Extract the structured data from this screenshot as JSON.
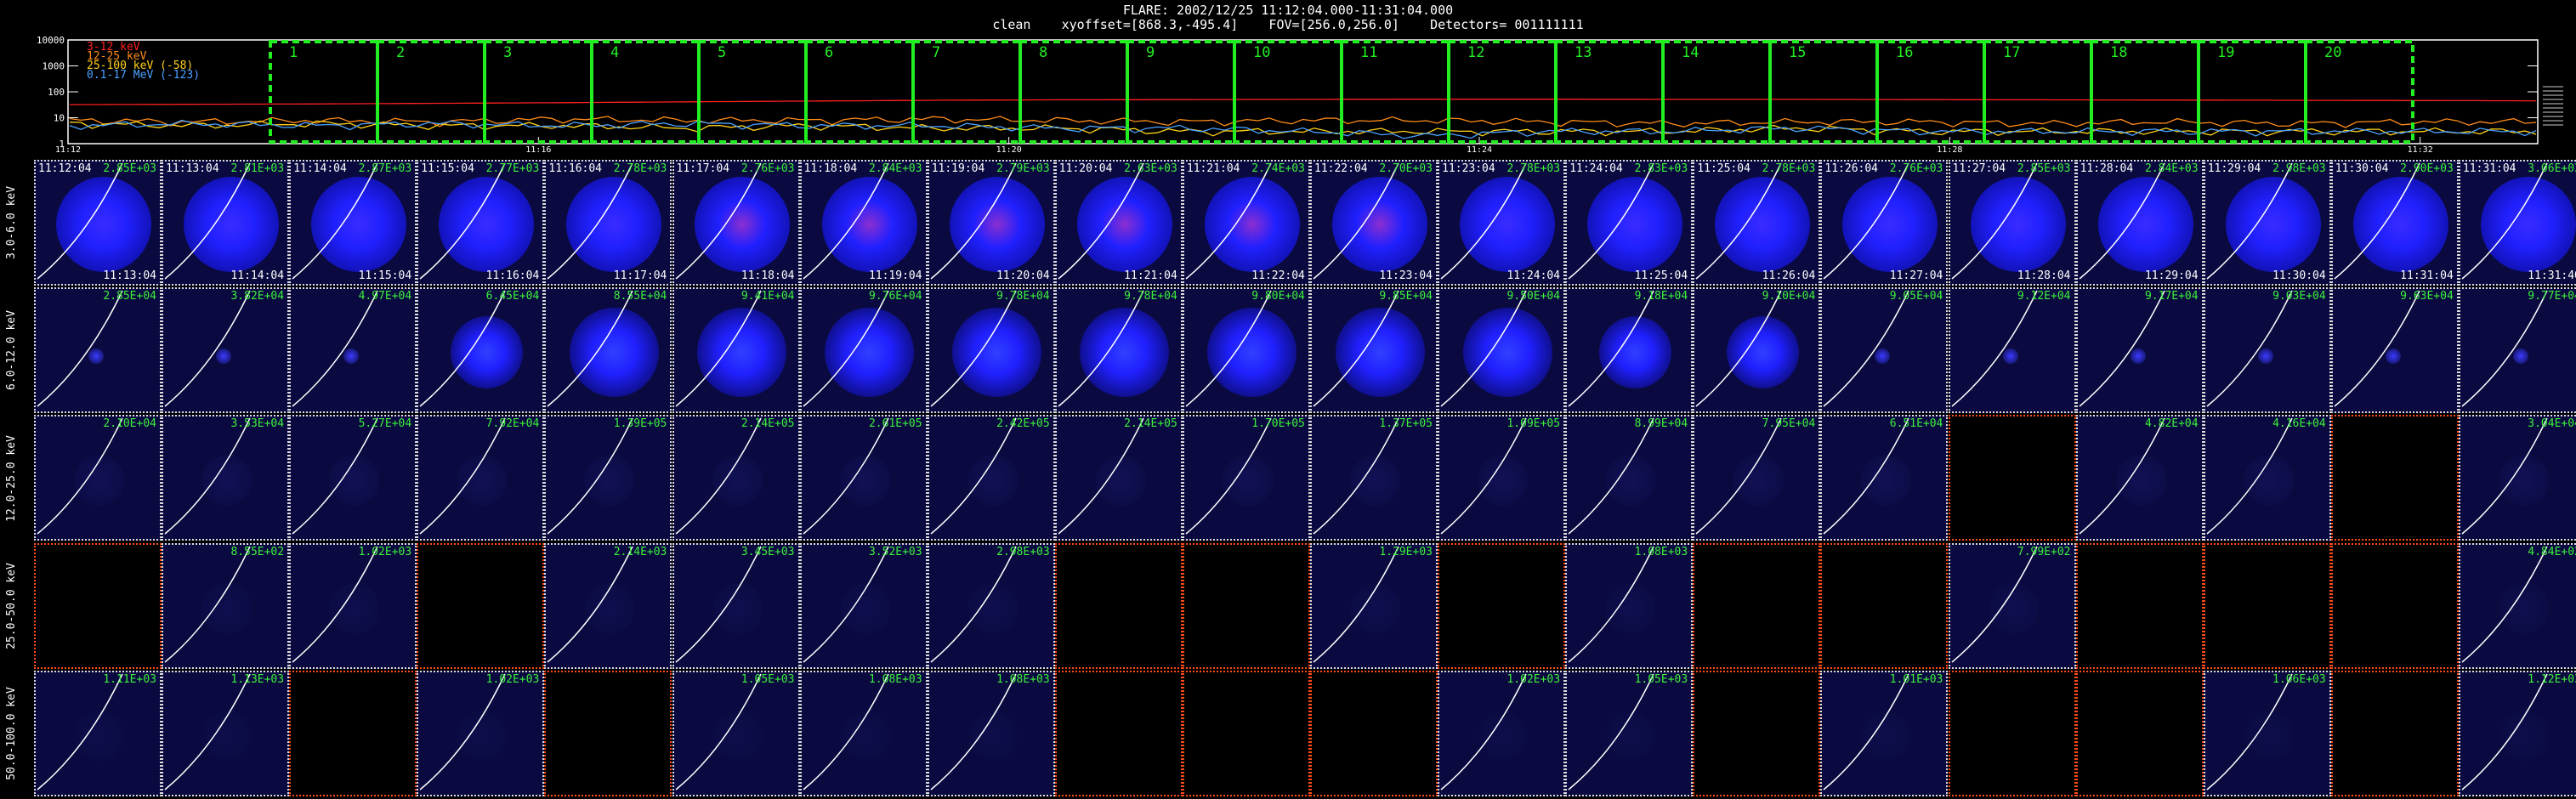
{
  "header": {
    "line1": "FLARE: 2002/12/25 11:12:04.000-11:31:04.000",
    "line2": "clean    xyoffset=[868.3,-495.4]    FOV=[256.0,256.0]    Detectors= 001111111"
  },
  "chart_data": {
    "type": "line",
    "title": "FLARE: 2002/12/25 11:12:04.000-11:31:04.000",
    "yscale": "log",
    "ylim": [
      1,
      10000
    ],
    "y_ticks": [
      "10000",
      "1000",
      "100",
      "10",
      "1"
    ],
    "x_ticks": [
      "11:12",
      "11:16",
      "11:20",
      "11:24",
      "11:28",
      "11:32"
    ],
    "xlim": [
      "11:12",
      "11:33"
    ],
    "legend_position": "top-left",
    "series": [
      {
        "name": "3-12 keV",
        "color": "#ff2020",
        "values": [
          32,
          33,
          34,
          36,
          38,
          41,
          44,
          47,
          49,
          50,
          51,
          52,
          52,
          51,
          51,
          50,
          49,
          48,
          47,
          46,
          45
        ]
      },
      {
        "name": "12-25 keV",
        "color": "#ff8c1a",
        "values": [
          8,
          7,
          8,
          7,
          9,
          8,
          8,
          9,
          8,
          7,
          8,
          8,
          7,
          6,
          7,
          7,
          6,
          7,
          6,
          7,
          7
        ]
      },
      {
        "name": "25-100 keV (-58)",
        "color": "#ffd21a",
        "values": [
          6,
          5,
          6,
          5,
          5,
          4,
          5,
          4,
          4,
          3,
          3,
          3,
          3,
          3,
          4,
          3,
          3,
          3,
          3,
          3,
          3
        ]
      },
      {
        "name": "0.1-17 MeV (-123)",
        "color": "#4aa0ff",
        "values": [
          5,
          6,
          5,
          6,
          5,
          6,
          5,
          5,
          4,
          4,
          3,
          2,
          3,
          3,
          4,
          3,
          3,
          3,
          3,
          3,
          3
        ]
      }
    ],
    "intervals": [
      "1",
      "2",
      "3",
      "4",
      "5",
      "6",
      "7",
      "8",
      "9",
      "10",
      "11",
      "12",
      "13",
      "14",
      "15",
      "16",
      "17",
      "18",
      "19",
      "20"
    ],
    "interval_color": "#22ee22"
  },
  "image_grid": {
    "row_labels": [
      "3.0-6.0 keV",
      "6.0-12.0 keV",
      "12.0-25.0 keV",
      "25.0-50.0 keV",
      "50.0-100.0 keV"
    ],
    "start_times": [
      "11:12:04",
      "11:13:04",
      "11:14:04",
      "11:15:04",
      "11:16:04",
      "11:17:04",
      "11:18:04",
      "11:19:04",
      "11:20:04",
      "11:21:04",
      "11:22:04",
      "11:23:04",
      "11:24:04",
      "11:25:04",
      "11:26:04",
      "11:27:04",
      "11:28:04",
      "11:29:04",
      "11:30:04",
      "11:31:04"
    ],
    "end_times": [
      "11:13:04",
      "11:14:04",
      "11:15:04",
      "11:16:04",
      "11:17:04",
      "11:18:04",
      "11:19:04",
      "11:20:04",
      "11:21:04",
      "11:22:04",
      "11:23:04",
      "11:24:04",
      "11:25:04",
      "11:26:04",
      "11:27:04",
      "11:28:04",
      "11:29:04",
      "11:30:04",
      "11:31:04",
      "11:31:40"
    ],
    "row1_values": [
      "2.85E+03",
      "2.81E+03",
      "2.87E+03",
      "2.77E+03",
      "2.78E+03",
      "2.76E+03",
      "2.84E+03",
      "2.79E+03",
      "2.63E+03",
      "2.74E+03",
      "2.70E+03",
      "2.78E+03",
      "2.83E+03",
      "2.78E+03",
      "2.76E+03",
      "2.85E+03",
      "2.84E+03",
      "2.98E+03",
      "2.90E+03",
      "3.06E+03"
    ],
    "row2_values": [
      "2.85E+04",
      "3.82E+04",
      "4.97E+04",
      "6.45E+04",
      "8.55E+04",
      "9.41E+04",
      "9.76E+04",
      "9.78E+04",
      "9.78E+04",
      "9.80E+04",
      "9.85E+04",
      "9.50E+04",
      "9.18E+04",
      "9.10E+04",
      "9.05E+04",
      "9.12E+04",
      "9.17E+04",
      "9.03E+04",
      "9.63E+04",
      "9.77E+04"
    ],
    "row3_values": [
      "2.10E+04",
      "3.53E+04",
      "5.27E+04",
      "7.92E+04",
      "1.39E+05",
      "2.14E+05",
      "2.61E+05",
      "2.42E+05",
      "2.14E+05",
      "1.70E+05",
      "1.37E+05",
      "1.09E+05",
      "8.99E+04",
      "7.95E+04",
      "6.51E+04",
      "",
      "4.82E+04",
      "4.16E+04",
      "",
      "3.04E+04"
    ],
    "row4_values": [
      "",
      "8.55E+02",
      "1.02E+03",
      "",
      "2.14E+03",
      "3.45E+03",
      "3.52E+03",
      "2.98E+03",
      "",
      "",
      "1.29E+03",
      "",
      "1.08E+03",
      "",
      "",
      "7.99E+02",
      "",
      "",
      "",
      "4.84E+02"
    ],
    "row5_values": [
      "1.11E+03",
      "1.13E+03",
      "",
      "1.02E+03",
      "",
      "1.05E+03",
      "1.08E+03",
      "1.08E+03",
      "",
      "",
      "",
      "1.02E+03",
      "1.05E+03",
      "",
      "1.01E+03",
      "",
      "",
      "1.06E+03",
      "",
      "1.12E+03"
    ]
  }
}
